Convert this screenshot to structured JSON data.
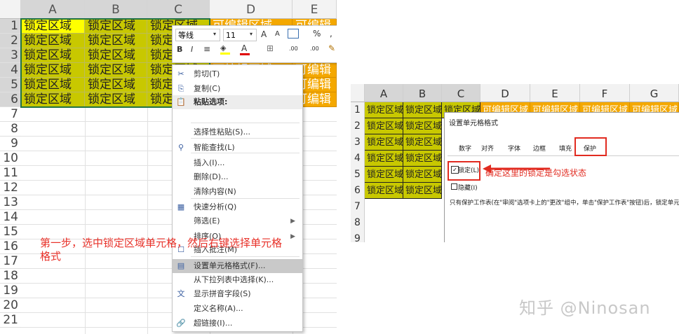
{
  "colors": {
    "locked": "#c8c800",
    "editable": "#f4a800",
    "header": "#f3f3f3",
    "selected_header": "#d6d6d6",
    "annotation": "#e8322a",
    "menu_highlight": "#c9c9c9"
  },
  "left": {
    "columns": [
      "A",
      "B",
      "C",
      "D",
      "E"
    ],
    "rows": [
      "1",
      "2",
      "3",
      "4",
      "5",
      "6",
      "7",
      "8",
      "9",
      "10",
      "11",
      "12",
      "13",
      "14",
      "15",
      "16",
      "17",
      "18",
      "19",
      "20",
      "21"
    ],
    "locked_text": "锁定区域",
    "locked_partial": "锁定",
    "locked_partial_c": "锁定区域",
    "editable_text": "可编辑区域",
    "editable_e": "可编辑",
    "cell_c3": "锁定区域",
    "d3": "可编辑区域",
    "mini": {
      "font": "等线",
      "size": "11",
      "bold": "B",
      "italic": "I",
      "align": "≡",
      "fill": "A",
      "fontcolor": "A",
      "border": "⊞",
      "dec": ".00",
      "paint": "✎",
      "grow": "A",
      "shrink": "A",
      "percent": "%",
      "comma": ","
    },
    "menu": [
      {
        "icon": "scissors-icon",
        "glyph": "✂",
        "label": "剪切(T)",
        "arrow": ""
      },
      {
        "icon": "copy-icon",
        "glyph": "⎘",
        "label": "复制(C)",
        "arrow": ""
      },
      {
        "icon": "paste-options-icon",
        "glyph": "📋",
        "label": "粘贴选项:",
        "arrow": "",
        "header": true
      },
      {
        "icon": "clipboard-icon",
        "glyph": "",
        "label": "",
        "arrow": ""
      },
      {
        "icon": "",
        "glyph": "",
        "label": "选择性粘贴(S)...",
        "arrow": ""
      },
      {
        "icon": "smart-lookup-icon",
        "glyph": "⚲",
        "label": "智能查找(L)",
        "arrow": ""
      },
      {
        "icon": "",
        "glyph": "",
        "label": "插入(I)...",
        "arrow": ""
      },
      {
        "icon": "",
        "glyph": "",
        "label": "删除(D)...",
        "arrow": ""
      },
      {
        "icon": "",
        "glyph": "",
        "label": "清除内容(N)",
        "arrow": ""
      },
      {
        "icon": "quick-analysis-icon",
        "glyph": "▦",
        "label": "快速分析(Q)",
        "arrow": ""
      },
      {
        "icon": "",
        "glyph": "",
        "label": "筛选(E)",
        "arrow": "▶"
      },
      {
        "icon": "",
        "glyph": "",
        "label": "排序(O)",
        "arrow": "▶"
      },
      {
        "icon": "insert-comment-icon",
        "glyph": "☐",
        "label": "插入批注(M)",
        "arrow": ""
      },
      {
        "icon": "format-cells-icon",
        "glyph": "▤",
        "label": "设置单元格格式(F)...",
        "arrow": "",
        "highlight": true
      },
      {
        "icon": "",
        "glyph": "",
        "label": "从下拉列表中选择(K)...",
        "arrow": ""
      },
      {
        "icon": "phonetic-icon",
        "glyph": "文",
        "label": "显示拼音字段(S)",
        "arrow": ""
      },
      {
        "icon": "",
        "glyph": "",
        "label": "定义名称(A)...",
        "arrow": ""
      },
      {
        "icon": "hyperlink-icon",
        "glyph": "🔗",
        "label": "超链接(I)...",
        "arrow": ""
      }
    ],
    "annotation": "第一步，选中锁定区域单元格，然后右键选择单元格格式"
  },
  "right": {
    "columns": [
      "A",
      "B",
      "C",
      "D",
      "E",
      "F",
      "G"
    ],
    "rows": [
      "1",
      "2",
      "3",
      "4",
      "5",
      "6",
      "7",
      "8",
      "9"
    ],
    "locked_text": "锁定区域",
    "editable_text": "可编辑区域",
    "dialog_title": "设置单元格格式",
    "tabs": [
      "数字",
      "对齐",
      "字体",
      "边框",
      "填充",
      "保护"
    ],
    "locked_label": "锁定(L)",
    "hidden_label": "隐藏(I)",
    "locked_checked": true,
    "hidden_checked": false,
    "callout": "确定这里的锁定是勾选状态",
    "info": "只有保护工作表(在\"审阅\"选项卡上的\"更改\"组中，单击\"保护工作表\"按钮)后，锁定单元格或隐藏"
  },
  "watermark": "知乎 @Ninosan"
}
